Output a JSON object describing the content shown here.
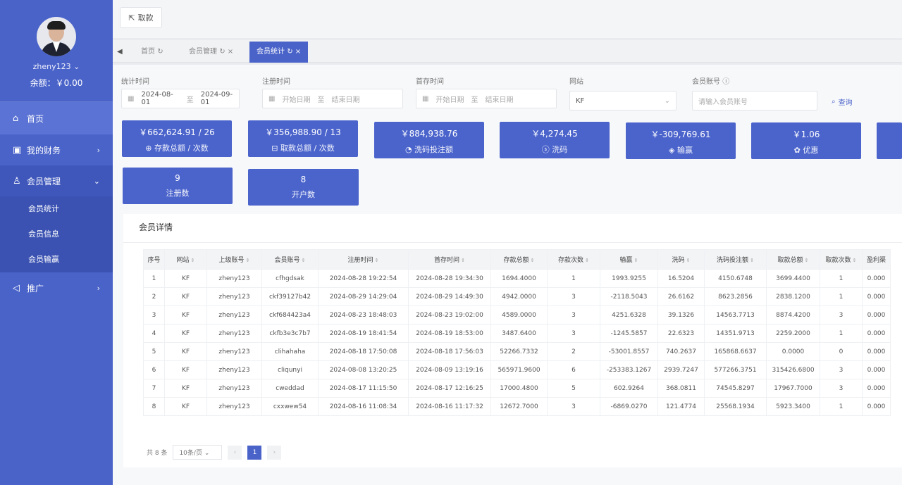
{
  "sidebar": {
    "username": "zheny123",
    "balance": "余额：￥0.00",
    "menu": [
      {
        "label": "首页",
        "icon": "home-icon"
      },
      {
        "label": "我的财务",
        "icon": "wallet-icon"
      },
      {
        "label": "会员管理",
        "icon": "user-icon"
      },
      {
        "label": "推广",
        "icon": "speaker-icon"
      }
    ],
    "sub_items": [
      "会员统计",
      "会员信息",
      "会员输赢"
    ]
  },
  "topbar": {
    "back_label": "取款"
  },
  "tabs": [
    {
      "label": "首页"
    },
    {
      "label": "会员管理"
    },
    {
      "label": "会员统计"
    }
  ],
  "filters": {
    "stat_time": {
      "label": "统计时间",
      "start": "2024-08-01",
      "sep": "至",
      "end": "2024-09-01"
    },
    "reg_time": {
      "label": "注册时间",
      "start": "开始日期",
      "sep": "至",
      "end": "结束日期"
    },
    "first_deposit_time": {
      "label": "首存时间",
      "start": "开始日期",
      "sep": "至",
      "end": "结束日期"
    },
    "site": {
      "label": "网站",
      "value": "KF"
    },
    "account": {
      "label": "会员账号",
      "placeholder": "请输入会员账号"
    },
    "search_label": "查询"
  },
  "stats": [
    {
      "value": "￥662,624.91 / 26",
      "label": "存款总额 / 次数"
    },
    {
      "value": "￥356,988.90 / 13",
      "label": "取款总额 / 次数"
    },
    {
      "value": "￥884,938.76",
      "label": "洗码投注额"
    },
    {
      "value": "￥4,274.45",
      "label": "洗码"
    },
    {
      "value": "￥-309,769.61",
      "label": "输赢"
    },
    {
      "value": "￥1.06",
      "label": "优惠"
    },
    {
      "value": "9",
      "label": "注册数"
    },
    {
      "value": "8",
      "label": "开户数"
    }
  ],
  "detail": {
    "title": "会员详情",
    "headers": [
      "序号",
      "网站",
      "上级账号",
      "会员账号",
      "注册时间",
      "首存时间",
      "存款总额",
      "存款次数",
      "输赢",
      "洗码",
      "洗码投注额",
      "取款总额",
      "取款次数",
      "盈利渠"
    ],
    "rows": [
      [
        "1",
        "KF",
        "zheny123",
        "cfhgdsak",
        "2024-08-28 19:22:54",
        "2024-08-28 19:34:30",
        "1694.4000",
        "1",
        "1993.9255",
        "16.5204",
        "4150.6748",
        "3699.4400",
        "1",
        "0.000"
      ],
      [
        "2",
        "KF",
        "zheny123",
        "ckf39127b42",
        "2024-08-29 14:29:04",
        "2024-08-29 14:49:30",
        "4942.0000",
        "3",
        "-2118.5043",
        "26.6162",
        "8623.2856",
        "2838.1200",
        "1",
        "0.000"
      ],
      [
        "3",
        "KF",
        "zheny123",
        "ckf684423a4",
        "2024-08-23 18:48:03",
        "2024-08-23 19:02:00",
        "4589.0000",
        "3",
        "4251.6328",
        "39.1326",
        "14563.7713",
        "8874.4200",
        "3",
        "0.000"
      ],
      [
        "4",
        "KF",
        "zheny123",
        "ckfb3e3c7b7",
        "2024-08-19 18:41:54",
        "2024-08-19 18:53:00",
        "3487.6400",
        "3",
        "-1245.5857",
        "22.6323",
        "14351.9713",
        "2259.2000",
        "1",
        "0.000"
      ],
      [
        "5",
        "KF",
        "zheny123",
        "clihahaha",
        "2024-08-18 17:50:08",
        "2024-08-18 17:56:03",
        "52266.7332",
        "2",
        "-53001.8557",
        "740.2637",
        "165868.6637",
        "0.0000",
        "0",
        "0.000"
      ],
      [
        "6",
        "KF",
        "zheny123",
        "cliqunyi",
        "2024-08-08 13:20:25",
        "2024-08-09 13:19:16",
        "565971.9600",
        "6",
        "-253383.1267",
        "2939.7247",
        "577266.3751",
        "315426.6800",
        "3",
        "0.000"
      ],
      [
        "7",
        "KF",
        "zheny123",
        "cweddad",
        "2024-08-17 11:15:50",
        "2024-08-17 12:16:25",
        "17000.4800",
        "5",
        "602.9264",
        "368.0811",
        "74545.8297",
        "17967.7000",
        "3",
        "0.000"
      ],
      [
        "8",
        "KF",
        "zheny123",
        "cxxwew54",
        "2024-08-16 11:08:34",
        "2024-08-16 11:17:32",
        "12672.7000",
        "3",
        "-6869.0270",
        "121.4774",
        "25568.1934",
        "5923.3400",
        "1",
        "0.000"
      ]
    ],
    "pager": {
      "total": "共 8 条",
      "page_size": "10条/页",
      "current": "1"
    }
  }
}
